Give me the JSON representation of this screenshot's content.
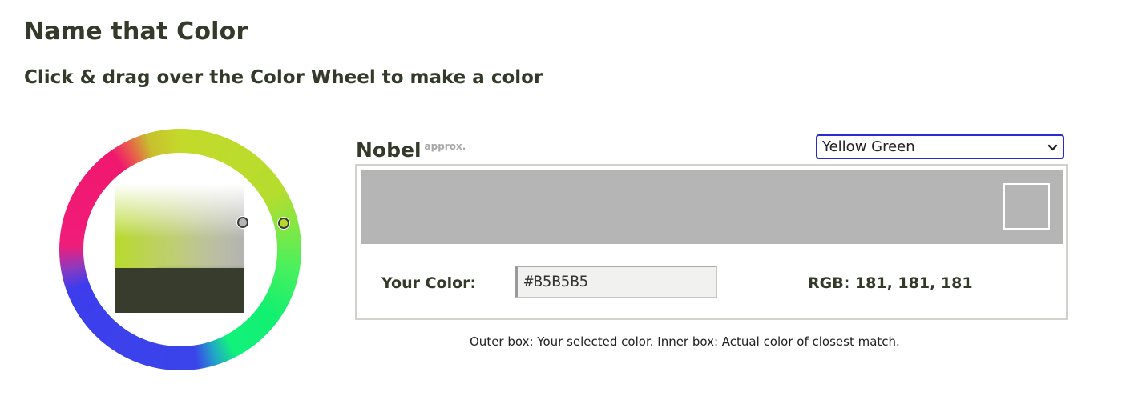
{
  "page": {
    "title": "Name that Color",
    "instructions": "Click & drag over the Color Wheel to make a color"
  },
  "wheel": {
    "selected_hue_color": "#b9d82c"
  },
  "result": {
    "name": "Nobel",
    "approx_label": "approx.",
    "hue_filter": {
      "selected": "Yellow Green"
    },
    "selected_color": "#B5B5B5",
    "match_color": "#B5B5B5",
    "your_color_label": "Your Color:",
    "hex_value": "#B5B5B5",
    "rgb_text": "RGB: 181, 181, 181",
    "caption": "Outer box: Your selected color. Inner box: Actual color of closest match."
  },
  "colors": {
    "text": "#333a2a",
    "box_border": "#d2d2cc",
    "select_border": "#2a2ad0"
  }
}
